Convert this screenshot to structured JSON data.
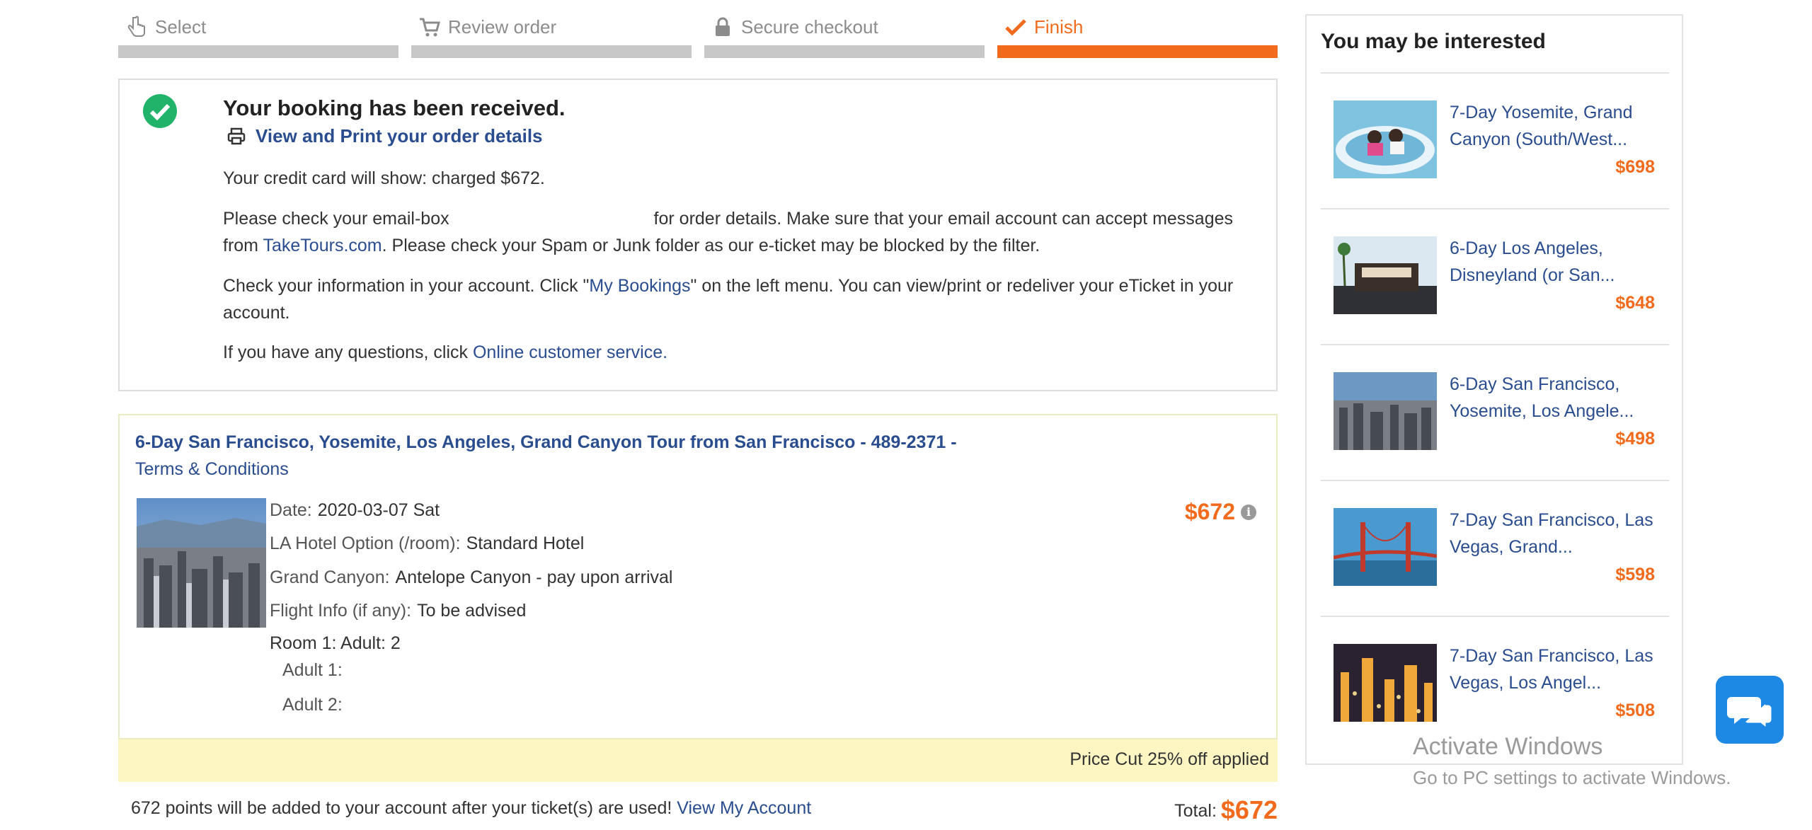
{
  "steps": [
    {
      "label": "Select",
      "icon": "hand-pointer-icon"
    },
    {
      "label": "Review order",
      "icon": "cart-icon"
    },
    {
      "label": "Secure checkout",
      "icon": "lock-icon"
    },
    {
      "label": "Finish",
      "icon": "checkmark-icon",
      "active": true
    }
  ],
  "confirmation": {
    "title": "Your booking has been received.",
    "print_link": "View and Print your order details",
    "charge_text": "Your credit card will show: charged $672.",
    "email_p1": "Please check your email-box",
    "email_p2": "for order details. Make sure that your email account can accept messages from",
    "email_link": "TakeTours.com",
    "email_p3": ". Please check your Spam or Junk folder as our e-ticket may be blocked by the filter.",
    "account_p1": "Check your information in your account. Click \"",
    "account_link": "My Bookings",
    "account_p2": "\" on the left menu. You can view/print or redeliver your eTicket in your account.",
    "questions_p1": "If you have any questions, click",
    "questions_link": "Online customer service."
  },
  "booking": {
    "tour_title": "6-Day San Francisco, Yosemite, Los Angeles, Grand Canyon Tour from San Francisco - 489-2371 -",
    "terms_link": "Terms & Conditions",
    "price": "$672",
    "details": [
      {
        "label": "Date:",
        "value": "2020-03-07 Sat"
      },
      {
        "label": "LA Hotel Option (/room):",
        "value": "Standard Hotel"
      },
      {
        "label": "Grand Canyon:",
        "value": "Antelope Canyon - pay upon arrival"
      },
      {
        "label": "Flight Info (if any):",
        "value": "To be advised"
      }
    ],
    "room": "Room 1: Adult: 2",
    "adult1": "Adult 1:",
    "adult2": "Adult 2:"
  },
  "price_cut": "Price Cut 25% off applied",
  "points_text": "672 points will be added to your account after your ticket(s) are used!",
  "view_account_link": "View My Account",
  "total_label": "Total:",
  "total_value": "$672",
  "sidebar": {
    "title": "You may be interested",
    "items": [
      {
        "name": "7-Day Yosemite, Grand Canyon (South/West...",
        "price": "$698"
      },
      {
        "name": "6-Day Los Angeles, Disneyland (or San...",
        "price": "$648"
      },
      {
        "name": "6-Day San Francisco, Yosemite, Los Angele...",
        "price": "$498"
      },
      {
        "name": "7-Day San Francisco, Las Vegas, Grand...",
        "price": "$598"
      },
      {
        "name": "7-Day San Francisco, Las Vegas, Los Angel...",
        "price": "$508"
      }
    ]
  },
  "watermark": {
    "line1": "Activate Windows",
    "line2": "Go to PC settings to activate Windows."
  },
  "colors": {
    "accent": "#f26b1d",
    "link": "#2a4d8f",
    "success": "#22b36a",
    "chat": "#1e88e5"
  }
}
